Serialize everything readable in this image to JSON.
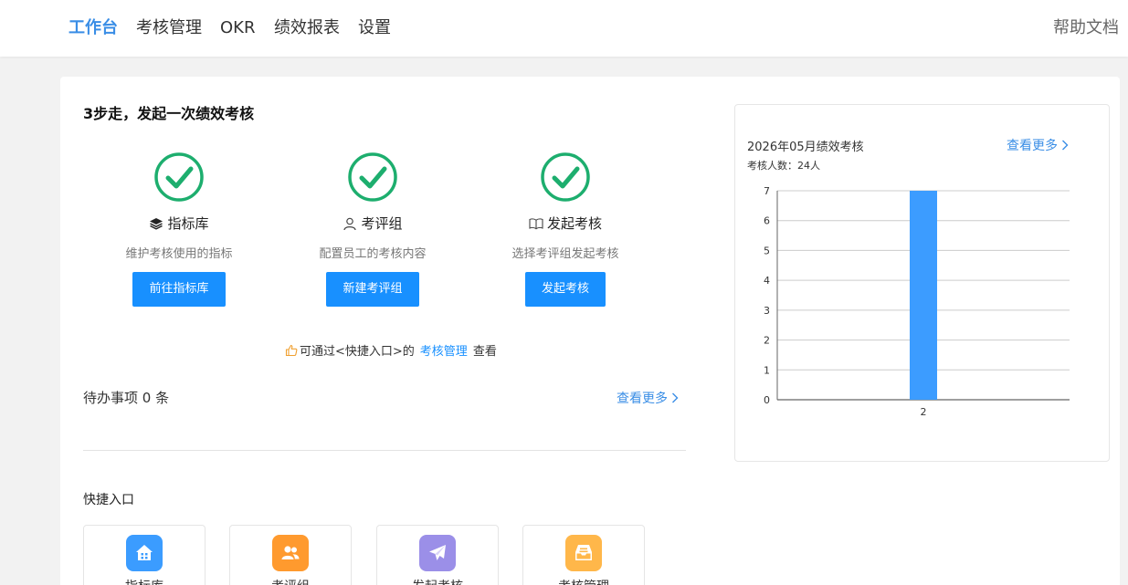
{
  "nav": {
    "items": [
      "工作台",
      "考核管理",
      "OKR",
      "绩效报表",
      "设置"
    ],
    "help": "帮助文档"
  },
  "steps": {
    "title": "3步走，发起一次绩效考核",
    "items": [
      {
        "name": "指标库",
        "icon": "layers-icon",
        "desc": "维护考核使用的指标",
        "button": "前往指标库"
      },
      {
        "name": "考评组",
        "icon": "user-outline-icon",
        "desc": "配置员工的考核内容",
        "button": "新建考评组"
      },
      {
        "name": "发起考核",
        "icon": "book-icon",
        "desc": "选择考评组发起考核",
        "button": "发起考核"
      }
    ]
  },
  "tip": {
    "prefix": "可通过<快捷入口>的",
    "link": "考核管理",
    "suffix": "查看"
  },
  "todo": {
    "title": "待办事项 0 条",
    "more": "查看更多"
  },
  "quick": {
    "title": "快捷入口",
    "items": [
      {
        "label": "指标库",
        "icon": "house-icon",
        "color": "#3b9cff"
      },
      {
        "label": "考评组",
        "icon": "users-icon",
        "color": "#ff9a2e"
      },
      {
        "label": "发起考核",
        "icon": "paper-plane-icon",
        "color": "#9b8fe8"
      },
      {
        "label": "考核管理",
        "icon": "inbox-icon",
        "color": "#ffb74a"
      }
    ]
  },
  "chart_panel": {
    "title": "2026年05月绩效考核",
    "subtitle": "考核人数：24人",
    "more": "查看更多"
  },
  "colors": {
    "accent": "#3a8ee6",
    "button": "#1890ff",
    "check": "#1dae6e",
    "bar": "#3c9cff"
  },
  "chart_data": {
    "type": "bar",
    "categories": [
      "2"
    ],
    "values": [
      7
    ],
    "ylim": [
      0,
      7
    ],
    "yticks": [
      0,
      1,
      2,
      3,
      4,
      5,
      6,
      7
    ],
    "grid": true
  }
}
